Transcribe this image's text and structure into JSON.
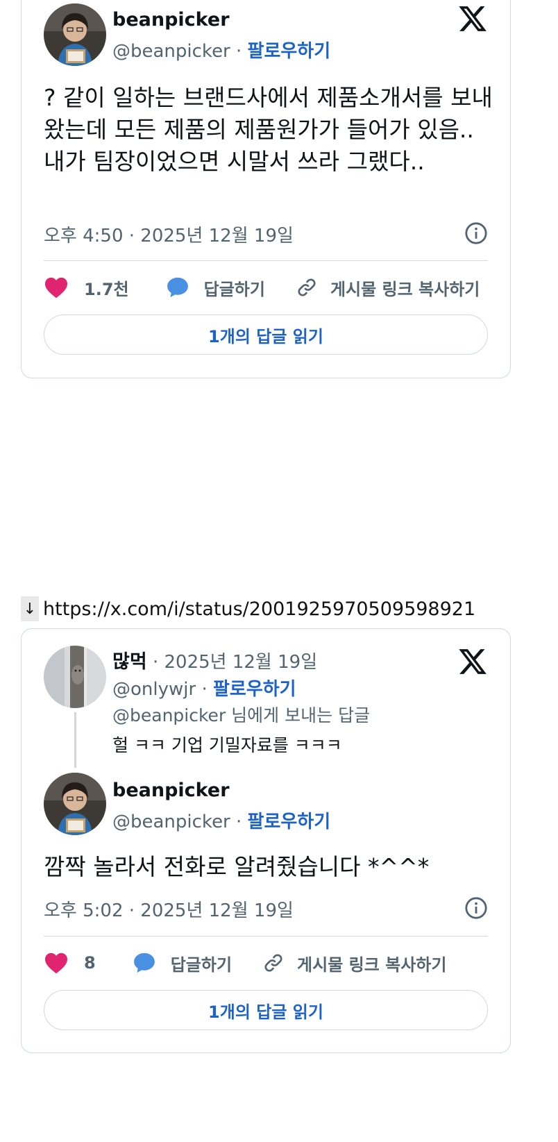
{
  "tweet1": {
    "author_name": "beanpicker",
    "author_handle": "@beanpicker",
    "follow_label": "팔로우하기",
    "text": "? 같이 일하는 브랜드사에서 제품소개서를 보내왔는데 모든 제품의 제품원가가 들어가 있음.. 내가 팀장이었으면 시말서 쓰라 그랬다..",
    "timestamp": "오후 4:50 · 2025년 12월 19일",
    "like_count": "1.7천",
    "reply_label": "답글하기",
    "copy_link_label": "게시물 링크 복사하기",
    "read_replies_label": "1개의 답글 읽기"
  },
  "link": {
    "arrow": "↓",
    "url": "https://x.com/i/status/2001925970509598921"
  },
  "tweet2": {
    "parent": {
      "author_name": "많먹",
      "date": "2025년 12월 19일",
      "author_handle": "@onlywjr",
      "follow_label": "팔로우하기",
      "replying_to_handle": "@beanpicker",
      "replying_to_suffix": " 님에게 보내는 답글",
      "text": "헐 ㅋㅋ 기업 기밀자료를 ㅋㅋㅋ"
    },
    "author_name": "beanpicker",
    "author_handle": "@beanpicker",
    "follow_label": "팔로우하기",
    "text": "깜짝 놀라서 전화로 알려줬습니다 *^^*",
    "timestamp": "오후 5:02 · 2025년 12월 19일",
    "like_count": "8",
    "reply_label": "답글하기",
    "copy_link_label": "게시물 링크 복사하기",
    "read_replies_label": "1개의 답글 읽기"
  },
  "colors": {
    "link_blue": "#1d62c9",
    "like_pink": "#e0246f",
    "reply_blue": "#4a90e2",
    "secondary_text": "#536471",
    "border": "#cfd9de"
  },
  "icons": [
    "x-logo-icon",
    "info-icon",
    "heart-icon",
    "speech-bubble-icon",
    "link-icon",
    "down-arrow-icon"
  ]
}
